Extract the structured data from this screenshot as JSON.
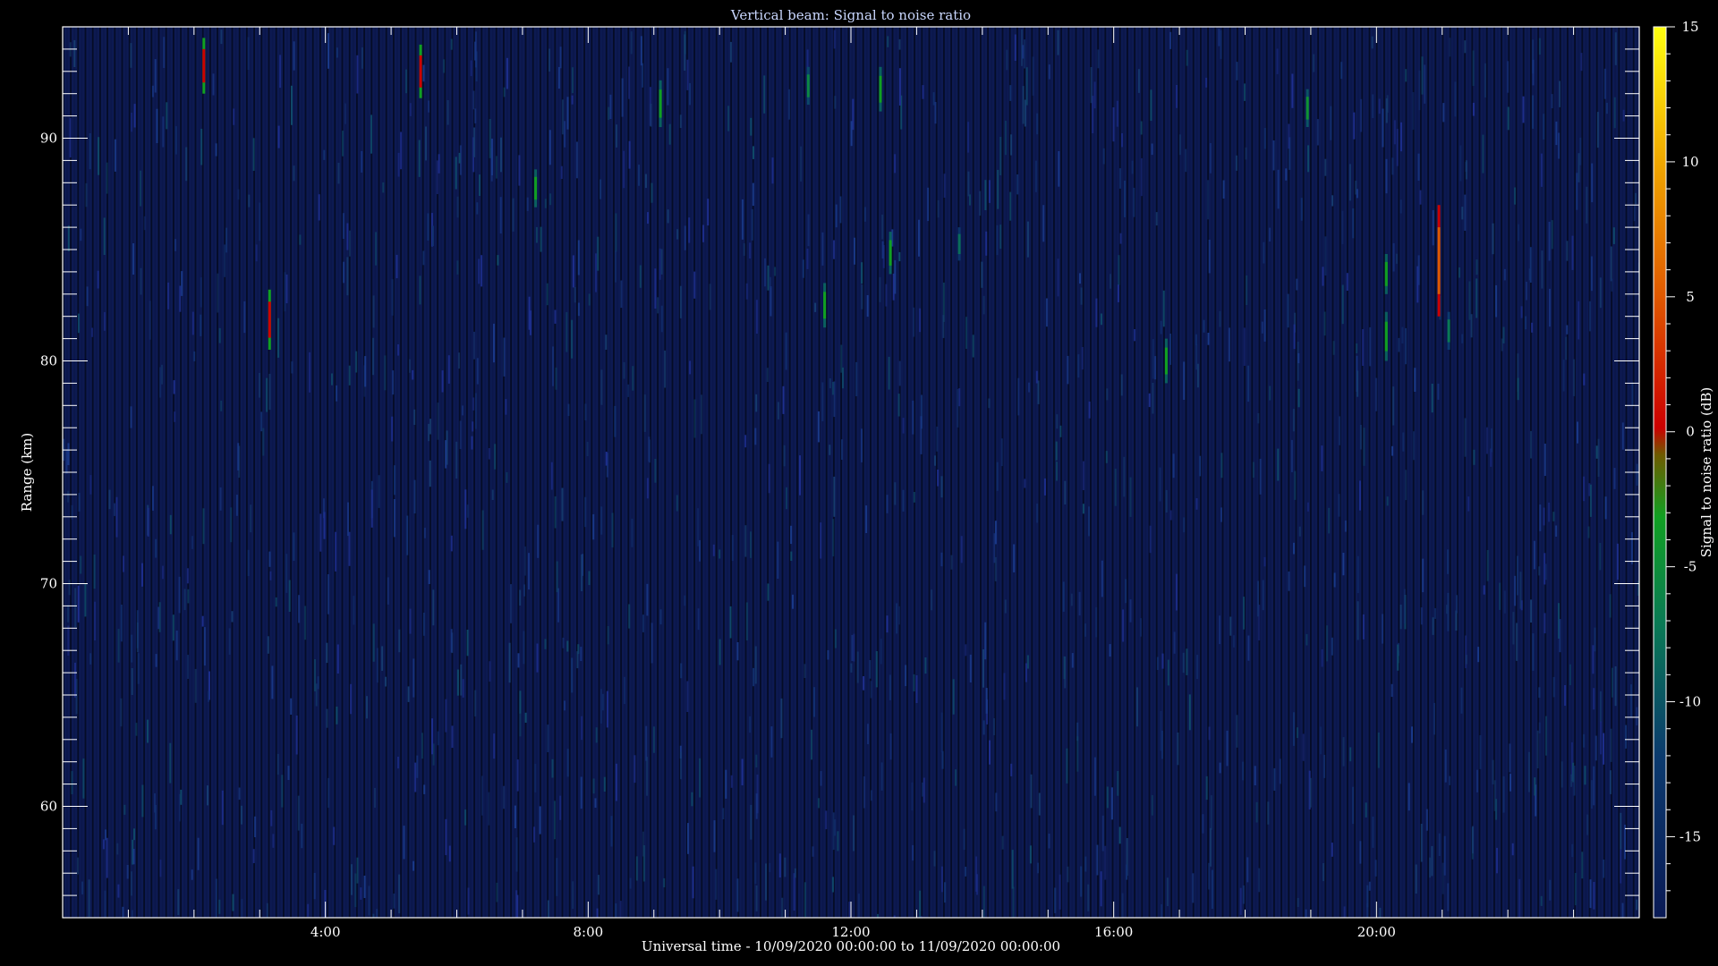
{
  "chart_data": {
    "type": "heatmap",
    "title": "Vertical beam: Signal to noise ratio",
    "xlabel": "Universal time - 10/09/2020 00:00:00 to 11/09/2020 00:00:00",
    "ylabel": "Range (km)",
    "colorbar_label": "Signal to noise ratio (dB)",
    "x_range_hours": [
      0,
      24
    ],
    "y_range_km": [
      55,
      95
    ],
    "color_range_db": [
      -18,
      15
    ],
    "x_ticks": [
      {
        "value": 4,
        "label": "4:00"
      },
      {
        "value": 8,
        "label": "8:00"
      },
      {
        "value": 12,
        "label": "12:00"
      },
      {
        "value": 16,
        "label": "16:00"
      },
      {
        "value": 20,
        "label": "20:00"
      }
    ],
    "y_ticks": [
      {
        "value": 60,
        "label": "60"
      },
      {
        "value": 70,
        "label": "70"
      },
      {
        "value": 80,
        "label": "80"
      },
      {
        "value": 90,
        "label": "90"
      }
    ],
    "colorbar_ticks": [
      {
        "value": -15,
        "label": "-15"
      },
      {
        "value": -10,
        "label": "-10"
      },
      {
        "value": -5,
        "label": "-5"
      },
      {
        "value": 0,
        "label": "0"
      },
      {
        "value": 5,
        "label": "5"
      },
      {
        "value": 10,
        "label": "10"
      },
      {
        "value": 15,
        "label": "15"
      }
    ],
    "background_level_db": -16,
    "echoes": [
      {
        "time_h": 2.15,
        "range_km": [
          92.0,
          94.5
        ],
        "snr_db": 0
      },
      {
        "time_h": 3.15,
        "range_km": [
          80.5,
          83.2
        ],
        "snr_db": 0
      },
      {
        "time_h": 5.45,
        "range_km": [
          91.8,
          94.2
        ],
        "snr_db": 0
      },
      {
        "time_h": 7.2,
        "range_km": [
          86.9,
          88.6
        ],
        "snr_db": -5
      },
      {
        "time_h": 9.1,
        "range_km": [
          90.5,
          92.6
        ],
        "snr_db": -5
      },
      {
        "time_h": 11.35,
        "range_km": [
          91.5,
          93.2
        ],
        "snr_db": -7
      },
      {
        "time_h": 11.6,
        "range_km": [
          81.5,
          83.5
        ],
        "snr_db": -5
      },
      {
        "time_h": 12.45,
        "range_km": [
          91.2,
          93.2
        ],
        "snr_db": -5
      },
      {
        "time_h": 12.6,
        "range_km": [
          83.9,
          85.8
        ],
        "snr_db": -5
      },
      {
        "time_h": 13.65,
        "range_km": [
          84.5,
          86.0
        ],
        "snr_db": -9
      },
      {
        "time_h": 16.8,
        "range_km": [
          79.0,
          81.0
        ],
        "snr_db": -5
      },
      {
        "time_h": 18.95,
        "range_km": [
          90.5,
          92.2
        ],
        "snr_db": -6
      },
      {
        "time_h": 20.15,
        "range_km": [
          83.0,
          84.8
        ],
        "snr_db": -5
      },
      {
        "time_h": 20.15,
        "range_km": [
          80.0,
          82.2
        ],
        "snr_db": -5
      },
      {
        "time_h": 20.95,
        "range_km": [
          82.0,
          87.0
        ],
        "snr_db": 5
      },
      {
        "time_h": 21.1,
        "range_km": [
          80.5,
          82.2
        ],
        "snr_db": -8
      }
    ]
  }
}
